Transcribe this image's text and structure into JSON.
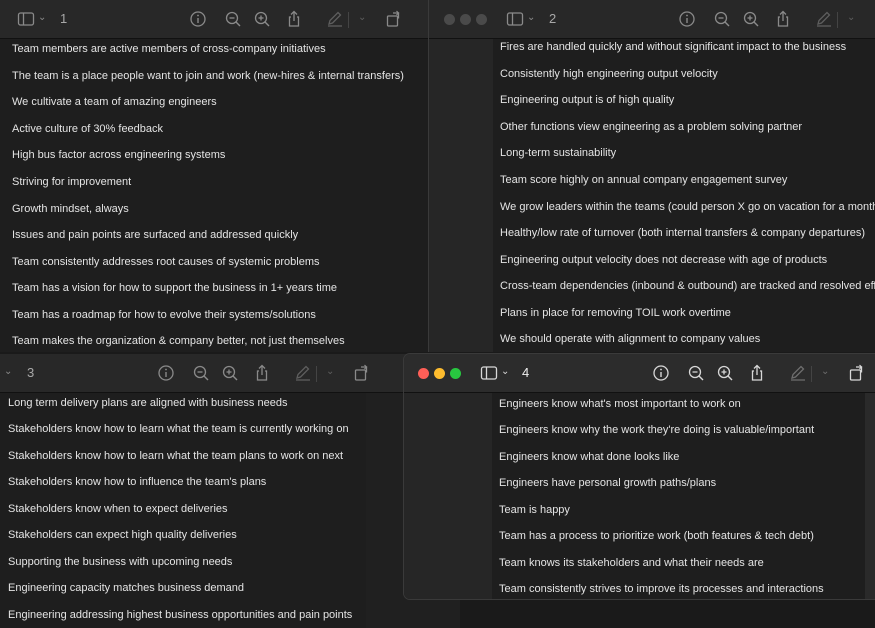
{
  "windows": [
    {
      "title": "1",
      "lines": [
        "Team members are active members of cross-company initiatives",
        "The team is a place people want to join and work (new-hires & internal transfers)",
        "We cultivate a team of amazing engineers",
        "Active culture of 30% feedback",
        "High bus factor across engineering systems",
        "Striving for improvement",
        "Growth mindset, always",
        "Issues and pain points are surfaced and addressed quickly",
        "Team consistently addresses root causes of systemic problems",
        "Team has a vision for how to support the business in 1+ years time",
        "Team has a roadmap for how to evolve their systems/solutions",
        "Team makes the organization & company better, not just themselves"
      ]
    },
    {
      "title": "2",
      "lines": [
        "Fires are handled quickly and without significant impact to the business",
        "Consistently high engineering output velocity",
        "Engineering output is of high quality",
        "Other functions view engineering as a problem solving partner",
        "Long-term sustainability",
        "Team score highly on annual company engagement survey",
        "We grow leaders within the teams (could person X go on vacation for a month?)",
        "Healthy/low rate of turnover (both internal transfers & company departures)",
        "Engineering output velocity does not decrease with age of products",
        "Cross-team dependencies (inbound & outbound) are tracked and resolved effic",
        "Plans in place for removing TOIL work overtime",
        "We should operate with alignment to company values"
      ]
    },
    {
      "title": "3",
      "lines": [
        "Long term delivery plans are aligned with business needs",
        "Stakeholders know how to learn what the team is currently working on",
        "Stakeholders know how to learn what the team plans to work on next",
        "Stakeholders know how to influence the team's plans",
        "Stakeholders know when to expect deliveries",
        "Stakeholders can expect high quality deliveries",
        "Supporting the business with upcoming needs",
        "Engineering capacity matches business demand",
        "Engineering addressing highest business opportunities and pain points"
      ]
    },
    {
      "title": "4",
      "lines": [
        "Engineers know what's most important to work on",
        "Engineers know why the work they're doing is valuable/important",
        "Engineers know what done looks like",
        "Engineers have personal growth paths/plans",
        "Team is happy",
        "Team has a process to prioritize work (both features & tech debt)",
        "Team knows its stakeholders and what their needs are",
        "Team consistently strives to improve its processes and interactions"
      ]
    }
  ],
  "colors": {
    "close": "#ff5f57",
    "minimize": "#febc2e",
    "zoom": "#28c840",
    "inactive_dot": "#4a4a4a"
  },
  "icons": [
    "sidebar-icon",
    "info-icon",
    "zoom-out-icon",
    "zoom-in-icon",
    "share-icon",
    "markup-icon",
    "rotate-icon"
  ]
}
